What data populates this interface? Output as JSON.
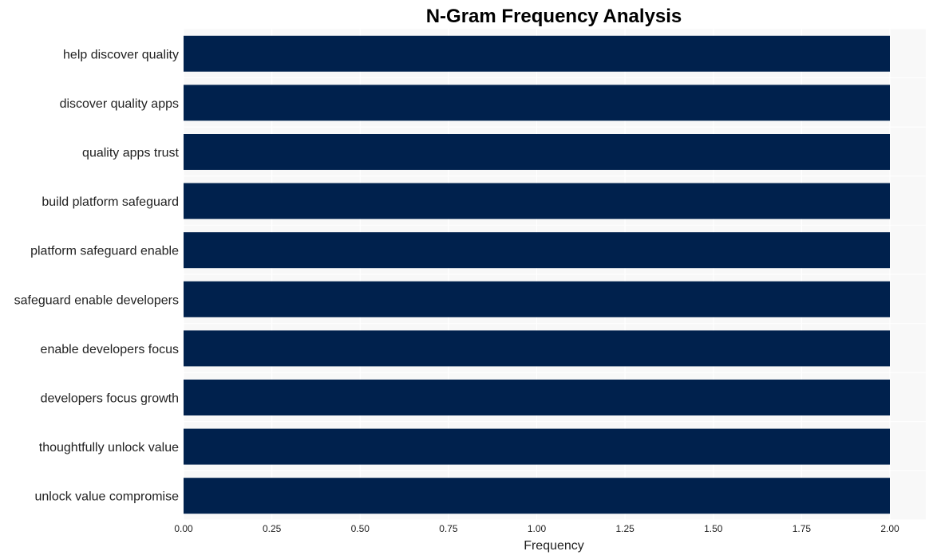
{
  "chart_data": {
    "type": "bar",
    "orientation": "horizontal",
    "title": "N-Gram Frequency Analysis",
    "xlabel": "Frequency",
    "ylabel": "",
    "categories": [
      "help discover quality",
      "discover quality apps",
      "quality apps trust",
      "build platform safeguard",
      "platform safeguard enable",
      "safeguard enable developers",
      "enable developers focus",
      "developers focus growth",
      "thoughtfully unlock value",
      "unlock value compromise"
    ],
    "values": [
      2,
      2,
      2,
      2,
      2,
      2,
      2,
      2,
      2,
      2
    ],
    "xlim": [
      0,
      2.1
    ],
    "xticks": [
      0,
      0.25,
      0.5,
      0.75,
      1.0,
      1.25,
      1.5,
      1.75,
      2.0
    ],
    "xtick_labels": [
      "0.00",
      "0.25",
      "0.50",
      "0.75",
      "1.00",
      "1.25",
      "1.50",
      "1.75",
      "2.00"
    ],
    "grid": true,
    "legend": "none",
    "colors": {
      "bar": "#00214d",
      "plot_background": "#f8f8f8",
      "grid": "#ffffff"
    }
  }
}
